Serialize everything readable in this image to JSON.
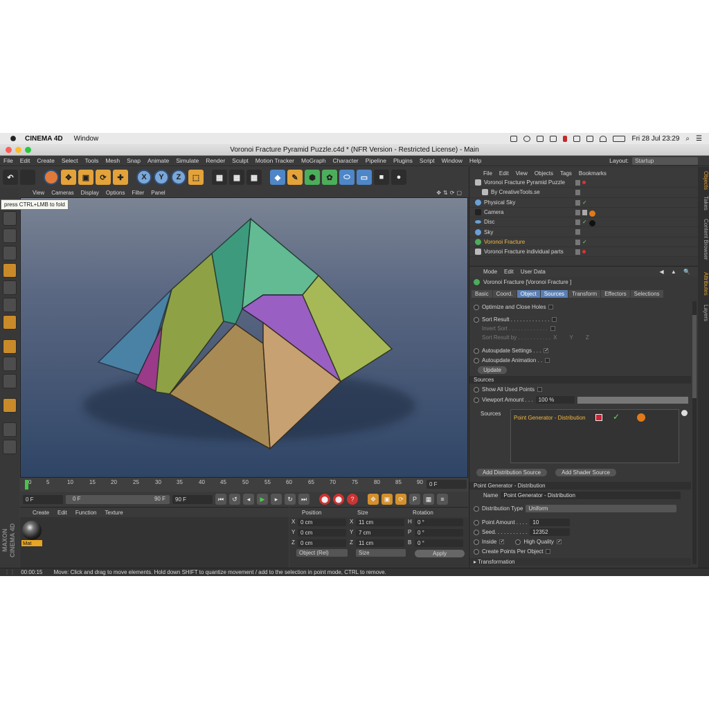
{
  "mac": {
    "app": "CINEMA 4D",
    "window_menu": "Window",
    "datetime": "Fri 28 Jul  23:29"
  },
  "window_title": "Voronoi Fracture Pyramid Puzzle.c4d * (NFR Version - Restricted License) - Main",
  "menu": [
    "File",
    "Edit",
    "Create",
    "Select",
    "Tools",
    "Mesh",
    "Snap",
    "Animate",
    "Simulate",
    "Render",
    "Sculpt",
    "Motion Tracker",
    "MoGraph",
    "Character",
    "Pipeline",
    "Plugins",
    "Script",
    "Window",
    "Help"
  ],
  "layout": {
    "label": "Layout:",
    "value": "Startup"
  },
  "tooltip": "press CTRL+LMB to fold",
  "viewport": {
    "menu": [
      "View",
      "Cameras",
      "Display",
      "Options",
      "Filter",
      "Panel"
    ]
  },
  "timeline": {
    "ticks": [
      "0",
      "5",
      "10",
      "15",
      "20",
      "25",
      "30",
      "35",
      "40",
      "45",
      "50",
      "55",
      "60",
      "65",
      "70",
      "75",
      "80",
      "85",
      "90"
    ],
    "end_field": "0 F",
    "start": "0 F",
    "range_start": "0 F",
    "range_end": "90 F",
    "end": "90 F"
  },
  "material": {
    "menu": [
      "Create",
      "Edit",
      "Function",
      "Texture"
    ],
    "name": "Mat"
  },
  "coords": {
    "headers": [
      "Position",
      "Size",
      "Rotation"
    ],
    "rows": [
      {
        "pl": "X",
        "pv": "0 cm",
        "sl": "X",
        "sv": "11 cm",
        "rl": "H",
        "rv": "0 °"
      },
      {
        "pl": "Y",
        "pv": "0 cm",
        "sl": "Y",
        "sv": "7 cm",
        "rl": "P",
        "rv": "0 °"
      },
      {
        "pl": "Z",
        "pv": "0 cm",
        "sl": "Z",
        "sv": "11 cm",
        "rl": "B",
        "rv": "0 °"
      }
    ],
    "mode": "Object (Rel)",
    "size_mode": "Size",
    "apply": "Apply"
  },
  "status": {
    "time": "00:00:15",
    "message": "Move: Click and drag to move elements. Hold down SHIFT to quantize movement / add to the selection in point mode, CTRL to remove."
  },
  "objects": {
    "menu": [
      "File",
      "Edit",
      "View",
      "Objects",
      "Tags",
      "Bookmarks"
    ],
    "items": [
      {
        "name": "Voronoi Fracture Pyramid Puzzle",
        "indent": 0,
        "color": "#bbbbbb",
        "check": ""
      },
      {
        "name": "By CreativeTools.se",
        "indent": 1,
        "color": "#bbbbbb",
        "check": ""
      },
      {
        "name": "Physical Sky",
        "indent": 0,
        "color": "#6aa0d8",
        "check": "✓"
      },
      {
        "name": "Camera",
        "indent": 0,
        "color": "#444444",
        "check": ""
      },
      {
        "name": "Disc",
        "indent": 0,
        "color": "#6aa0d8",
        "check": "✓"
      },
      {
        "name": "Sky",
        "indent": 0,
        "color": "#6aa0d8",
        "check": ""
      },
      {
        "name": "Voronoi Fracture",
        "indent": 0,
        "color": "#4cae5a",
        "check": "✓",
        "selected": true
      },
      {
        "name": "Voronoi Fracture individual parts",
        "indent": 0,
        "color": "#bbbbbb",
        "check": ""
      }
    ]
  },
  "attributes": {
    "menu": [
      "Mode",
      "Edit",
      "User Data"
    ],
    "title": "Voronoi Fracture [Voronoi Fracture ]",
    "tabs": [
      "Basic",
      "Coord.",
      "Object",
      "Sources",
      "Transform",
      "Effectors",
      "Selections"
    ],
    "optimize": "Optimize and Close Holes",
    "sort_result": "Sort Result . . . . . . . . . . . . .",
    "invert_sort": "Invert Sort . . . . . . . . . . . . .",
    "sort_by": "Sort Result by . . . . . . . . . . .",
    "sort_axes": [
      "X",
      "Y",
      "Z"
    ],
    "autoupdate_settings": "Autoupdate Settings . . .",
    "autoupdate_animation": "Autoupdate Animation . .",
    "update": "Update",
    "sources_header": "Sources",
    "show_all": "Show All Used Points",
    "viewport_amount_label": "Viewport Amount . . .",
    "viewport_amount": "100 %",
    "sources_label": "Sources",
    "source_item": "Point Generator - Distribution",
    "add_distribution": "Add Distribution Source",
    "add_shader": "Add Shader Source",
    "pg_header": "Point Generator - Distribution",
    "name_label": "Name",
    "name_value": "Point Generator - Distribution",
    "dist_type_label": "Distribution Type",
    "dist_type": "Uniform",
    "point_amount_label": "Point Amount . . . .",
    "point_amount": "10",
    "seed_label": "Seed. . . . . . . . . . .",
    "seed": "12352",
    "inside": "Inside",
    "high_quality": "High Quality",
    "create_points": "Create Points Per Object",
    "transformation": "Transformation"
  },
  "side_tabs": [
    "Objects",
    "Takes",
    "Content Browser",
    "Attributes",
    "Layers"
  ]
}
